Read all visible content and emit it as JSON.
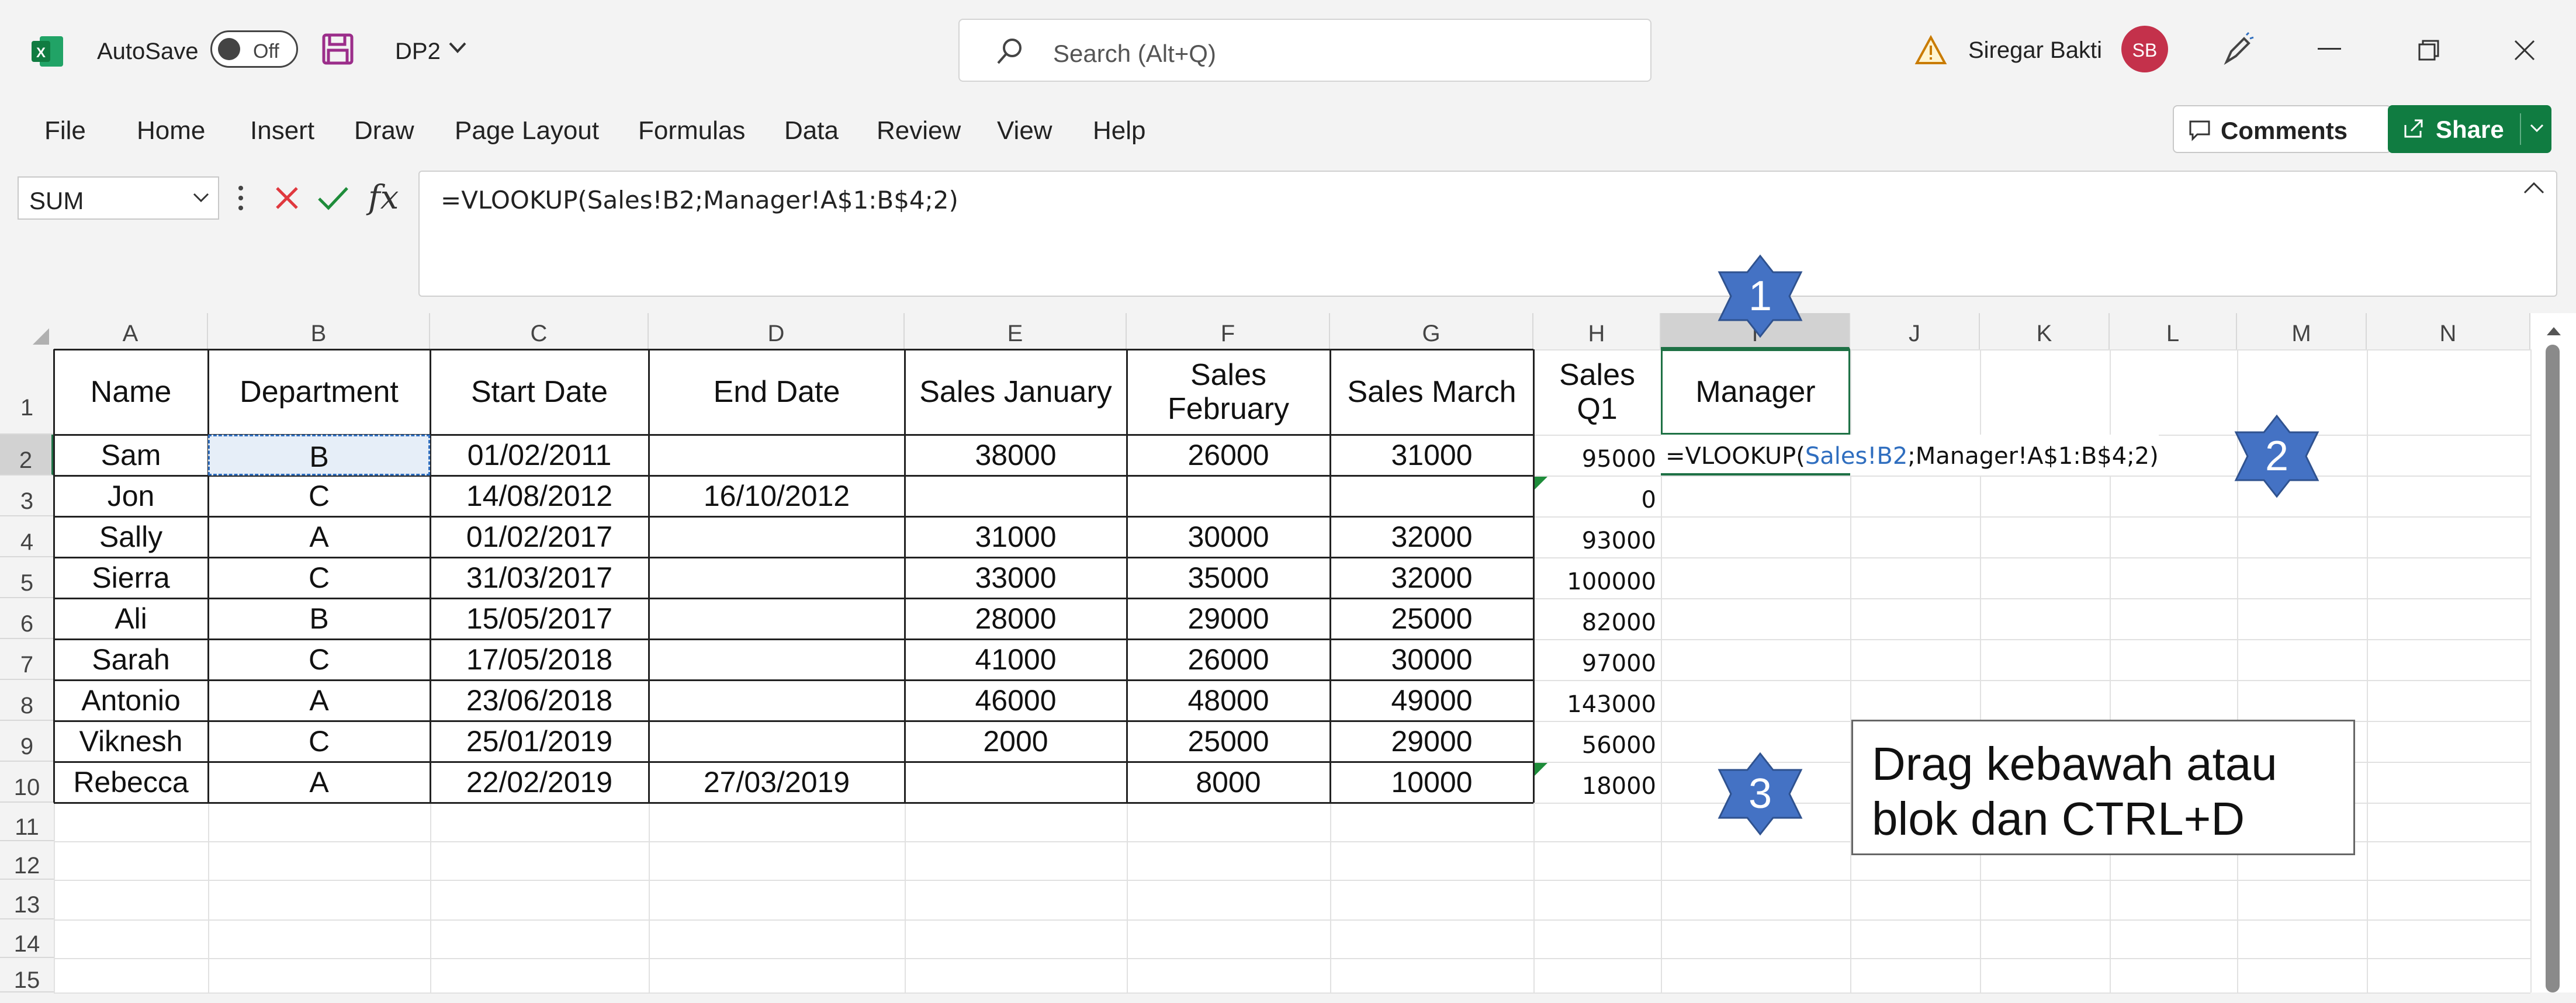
{
  "titlebar": {
    "autosave_label": "AutoSave",
    "autosave_state": "Off",
    "doc_name": "DP2",
    "search_placeholder": "Search (Alt+Q)",
    "user_name": "Siregar Bakti",
    "user_initials": "SB"
  },
  "ribbon": {
    "tabs": [
      "File",
      "Home",
      "Insert",
      "Draw",
      "Page Layout",
      "Formulas",
      "Data",
      "Review",
      "View",
      "Help"
    ],
    "comments_label": "Comments",
    "share_label": "Share"
  },
  "formula_bar": {
    "name_box": "SUM",
    "fx": "fx",
    "formula": "=VLOOKUP(Sales!B2;Manager!A$1:B$4;2)"
  },
  "sheet": {
    "columns": [
      "A",
      "B",
      "C",
      "D",
      "E",
      "F",
      "G",
      "H",
      "I",
      "J",
      "K",
      "L",
      "M",
      "N"
    ],
    "rows": [
      "1",
      "2",
      "3",
      "4",
      "5",
      "6",
      "7",
      "8",
      "9",
      "10",
      "11",
      "12",
      "13",
      "14",
      "15"
    ],
    "headers": [
      "Name",
      "Department",
      "Start Date",
      "End Date",
      "Sales January",
      "Sales February",
      "Sales March",
      "Sales Q1",
      "Manager"
    ],
    "data": [
      [
        "Sam",
        "B",
        "01/02/2011",
        "",
        "38000",
        "26000",
        "31000",
        "95000"
      ],
      [
        "Jon",
        "C",
        "14/08/2012",
        "16/10/2012",
        "",
        "",
        "",
        "0"
      ],
      [
        "Sally",
        "A",
        "01/02/2017",
        "",
        "31000",
        "30000",
        "32000",
        "93000"
      ],
      [
        "Sierra",
        "C",
        "31/03/2017",
        "",
        "33000",
        "35000",
        "32000",
        "100000"
      ],
      [
        "Ali",
        "B",
        "15/05/2017",
        "",
        "28000",
        "29000",
        "25000",
        "82000"
      ],
      [
        "Sarah",
        "C",
        "17/05/2018",
        "",
        "41000",
        "26000",
        "30000",
        "97000"
      ],
      [
        "Antonio",
        "A",
        "23/06/2018",
        "",
        "46000",
        "48000",
        "49000",
        "143000"
      ],
      [
        "Viknesh",
        "C",
        "25/01/2019",
        "",
        "2000",
        "25000",
        "29000",
        "56000"
      ],
      [
        "Rebecca",
        "A",
        "22/02/2019",
        "27/03/2019",
        "",
        "8000",
        "10000",
        "18000"
      ]
    ],
    "edit_formula_parts": [
      "=VLOOKUP(",
      "Sales!B2",
      ";Manager!A$1:B$4;2)"
    ]
  },
  "annotations": {
    "badge1": "1",
    "badge2": "2",
    "badge3": "3",
    "callout": "Drag kebawah atau\nblok dan CTRL+D"
  },
  "colors": {
    "excel_green": "#1e7145",
    "share_green": "#107c41",
    "badge_blue": "#4472c4",
    "ref_blue": "#2f6ebf",
    "avatar_red": "#c4314b"
  }
}
